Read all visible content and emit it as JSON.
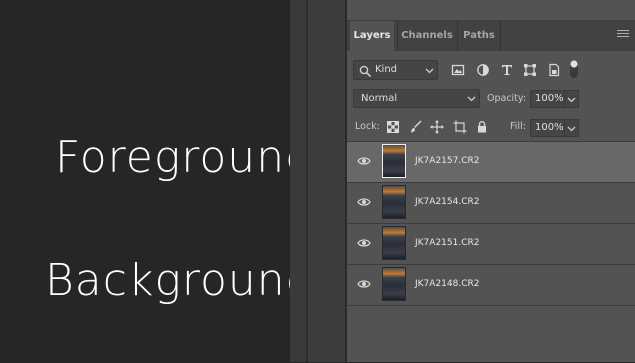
{
  "annotations": {
    "foreground": "Foreground",
    "background": "Background"
  },
  "tabs": [
    {
      "label": "Layers",
      "active": true
    },
    {
      "label": "Channels",
      "active": false
    },
    {
      "label": "Paths",
      "active": false
    }
  ],
  "filter": {
    "kind_label": "Kind",
    "icons": [
      "image-filter-icon",
      "adjustment-filter-icon",
      "type-filter-icon",
      "shape-filter-icon",
      "smart-object-filter-icon",
      "filter-toggle-icon"
    ]
  },
  "blend": {
    "mode": "Normal",
    "opacity_label": "Opacity:",
    "opacity_value": "100%"
  },
  "lock": {
    "label": "Lock:",
    "icons": [
      "lock-transparent-pixels-icon",
      "lock-image-pixels-icon",
      "lock-position-icon",
      "lock-artboard-icon",
      "lock-all-icon"
    ],
    "fill_label": "Fill:",
    "fill_value": "100%"
  },
  "layers": [
    {
      "name": "JK7A2157.CR2",
      "selected": true,
      "visible": true
    },
    {
      "name": "JK7A2154.CR2",
      "selected": false,
      "visible": true
    },
    {
      "name": "JK7A2151.CR2",
      "selected": false,
      "visible": true
    },
    {
      "name": "JK7A2148.CR2",
      "selected": false,
      "visible": true
    }
  ],
  "colors": {
    "panel_bg": "#535353",
    "selected_row": "#686868",
    "canvas_bg": "#262626"
  }
}
